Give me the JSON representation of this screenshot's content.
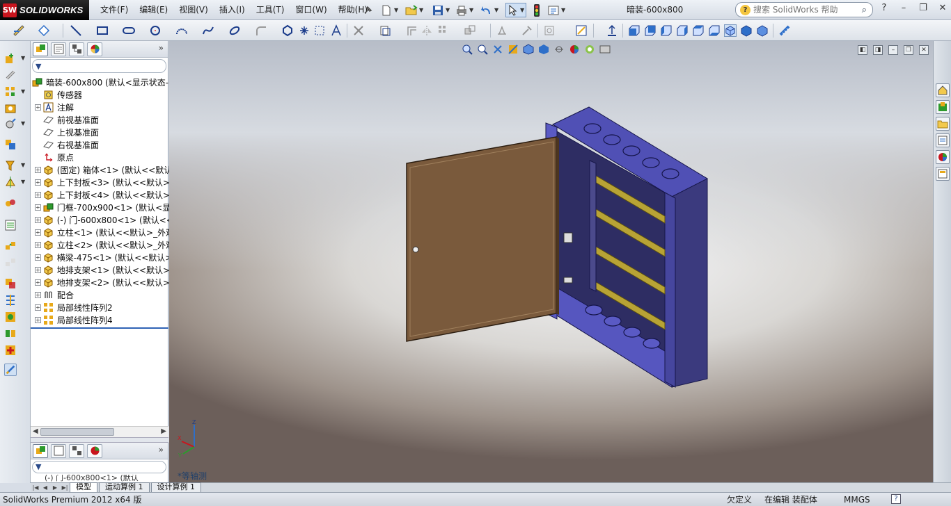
{
  "app": {
    "brand": "SOLIDWORKS",
    "logo_mark": "SW",
    "menu": [
      "文件(F)",
      "编辑(E)",
      "视图(V)",
      "插入(I)",
      "工具(T)",
      "窗口(W)",
      "帮助(H)"
    ],
    "document_title": "暗装-600x800",
    "search_placeholder": "搜索 SolidWorks 帮助",
    "help_glyph": "?",
    "search_glyph": "⌕",
    "window_controls": [
      "–",
      "❐",
      "✕"
    ]
  },
  "feature_tree": {
    "root": "暗装-600x800  (默认<显示状态-",
    "nodes": [
      {
        "label": "传感器",
        "icon": "sensor-icon",
        "expandable": false
      },
      {
        "label": "注解",
        "icon": "annotation-icon",
        "expandable": true
      },
      {
        "label": "前视基准面",
        "icon": "plane-icon",
        "expandable": false
      },
      {
        "label": "上视基准面",
        "icon": "plane-icon",
        "expandable": false
      },
      {
        "label": "右视基准面",
        "icon": "plane-icon",
        "expandable": false
      },
      {
        "label": "原点",
        "icon": "origin-icon",
        "expandable": false
      },
      {
        "label": "(固定) 箱体<1> (默认<<默认",
        "icon": "part-icon",
        "expandable": true
      },
      {
        "label": "上下封板<3> (默认<<默认>",
        "icon": "part-icon",
        "expandable": true
      },
      {
        "label": "上下封板<4> (默认<<默认>",
        "icon": "part-icon",
        "expandable": true
      },
      {
        "label": "门框-700x900<1> (默认<显",
        "icon": "subassembly-icon",
        "expandable": true
      },
      {
        "label": "(-) 门-600x800<1> (默认<<",
        "icon": "part-icon",
        "expandable": true
      },
      {
        "label": "立柱<1> (默认<<默认>_外观",
        "icon": "part-icon",
        "expandable": true
      },
      {
        "label": "立柱<2> (默认<<默认>_外观",
        "icon": "part-icon",
        "expandable": true
      },
      {
        "label": "横梁-475<1> (默认<<默认>",
        "icon": "part-icon",
        "expandable": true
      },
      {
        "label": "地排支架<1> (默认<<默认>",
        "icon": "part-icon",
        "expandable": true
      },
      {
        "label": "地排支架<2> (默认<<默认>",
        "icon": "part-icon",
        "expandable": true
      },
      {
        "label": "配合",
        "icon": "mates-icon",
        "expandable": true
      },
      {
        "label": "局部线性阵列2",
        "icon": "linear-pattern-icon",
        "expandable": true
      },
      {
        "label": "局部线性阵列4",
        "icon": "linear-pattern-icon",
        "expandable": true
      }
    ],
    "more_glyph": "»",
    "secondary_item": "(-) 门-600x800<1> (默认"
  },
  "viewport": {
    "view_label": "*等轴测",
    "triad": {
      "x": "X",
      "y": "Y",
      "z": "Z"
    },
    "colors": {
      "cabinet": "#4a4aa8",
      "door": "#7a5a3c",
      "rail": "#b8a335"
    }
  },
  "bottom_tabs": [
    "模型",
    "运动算例 1",
    "设计算例 1"
  ],
  "status": {
    "product": "SolidWorks Premium 2012 x64 版",
    "definition": "欠定义",
    "editing": "在编辑 装配体",
    "units": "MMGS",
    "help": "?"
  }
}
